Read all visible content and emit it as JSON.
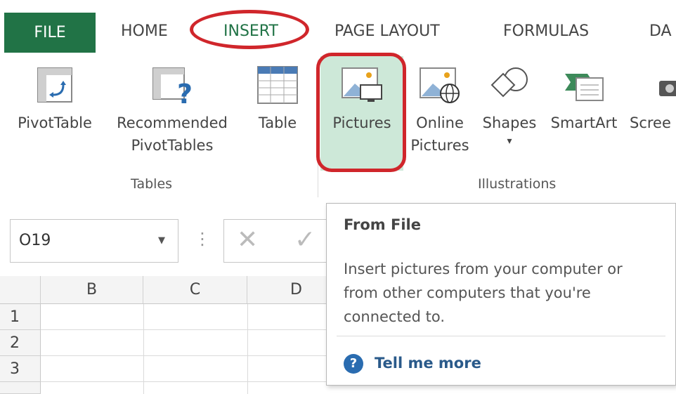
{
  "tabs": {
    "file": "FILE",
    "home": "HOME",
    "insert": "INSERT",
    "page_layout": "PAGE LAYOUT",
    "formulas": "FORMULAS",
    "data": "DA"
  },
  "ribbon": {
    "tables_group": "Tables",
    "illustrations_group": "Illustrations",
    "buttons": {
      "pivottable": "PivotTable",
      "recommended_1": "Recommended",
      "recommended_2": "PivotTables",
      "table": "Table",
      "pictures": "Pictures",
      "online_1": "Online",
      "online_2": "Pictures",
      "shapes": "Shapes",
      "shapes_arrow": "▾",
      "smartart": "SmartArt",
      "screenshot": "Scree"
    }
  },
  "formula_bar": {
    "name_box": "O19",
    "cancel": "✕",
    "enter": "✓"
  },
  "grid": {
    "columns": [
      "B",
      "C",
      "D"
    ],
    "rows": [
      "1",
      "2",
      "3"
    ]
  },
  "tooltip": {
    "title": "From File",
    "body": "Insert pictures from your computer or from other computers that you're connected to.",
    "help": "Tell me more"
  },
  "colors": {
    "accent": "#217346",
    "highlight": "#d0262b",
    "selected_button": "#cde8d8"
  }
}
